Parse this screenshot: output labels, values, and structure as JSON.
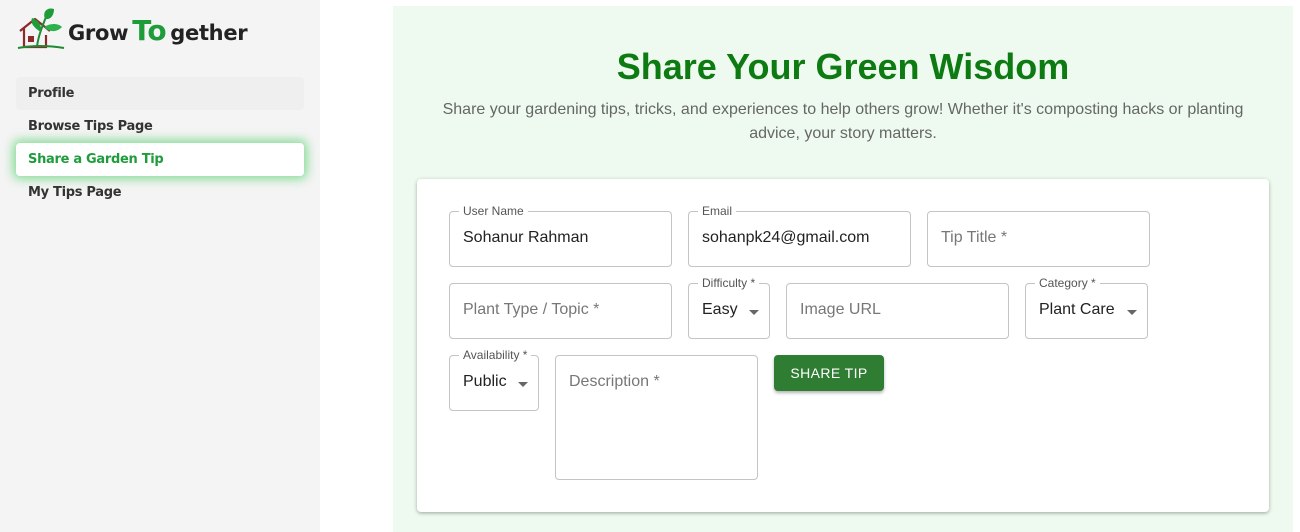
{
  "brand": {
    "part1": "Grow",
    "part2": "To",
    "part3": "gether"
  },
  "sidebar": {
    "items": [
      {
        "label": "Profile"
      },
      {
        "label": "Browse Tips Page"
      },
      {
        "label": "Share a Garden Tip"
      },
      {
        "label": "My Tips Page"
      }
    ]
  },
  "main": {
    "title": "Share Your Green Wisdom",
    "subtitle": "Share your gardening tips, tricks, and experiences to help others grow! Whether it's composting hacks or planting advice, your story matters."
  },
  "form": {
    "user_name": {
      "label": "User Name",
      "value": "Sohanur Rahman"
    },
    "email": {
      "label": "Email",
      "value": "sohanpk24@gmail.com"
    },
    "tip_title": {
      "placeholder": "Tip Title *"
    },
    "plant_type": {
      "placeholder": "Plant Type / Topic *"
    },
    "difficulty": {
      "label": "Difficulty *",
      "value": "Easy"
    },
    "image_url": {
      "placeholder": "Image URL"
    },
    "category": {
      "label": "Category *",
      "value": "Plant Care"
    },
    "availability": {
      "label": "Availability *",
      "value": "Public"
    },
    "description": {
      "placeholder": "Description *"
    },
    "submit_label": "SHARE TIP"
  },
  "colors": {
    "accent": "#1e9c3a",
    "title_green": "#0d7a12",
    "button": "#2e7d32",
    "main_bg": "#eefaef"
  },
  "icons": [
    "house-plant-logo-icon",
    "chevron-down-icon"
  ]
}
